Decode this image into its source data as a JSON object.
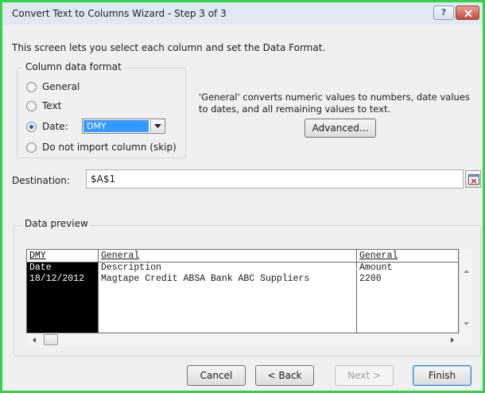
{
  "window": {
    "title": "Convert Text to Columns Wizard - Step 3 of 3",
    "help_glyph": "?"
  },
  "intro_text": "This screen lets you select each column and set the Data Format.",
  "column_format": {
    "legend": "Column data format",
    "options": [
      {
        "label": "General",
        "selected": false
      },
      {
        "label": "Text",
        "selected": false
      },
      {
        "label": "Date:",
        "selected": true
      },
      {
        "label": "Do not import column (skip)",
        "selected": false
      }
    ],
    "date_value": "DMY"
  },
  "general_note": "'General' converts numeric values to numbers, date values to dates, and all remaining values to text.",
  "advanced_label": "Advanced...",
  "destination": {
    "label": "Destination:",
    "value": "$A$1"
  },
  "preview": {
    "legend": "Data preview",
    "headers": [
      "DMY",
      "General",
      "General"
    ],
    "rows": [
      [
        "Date",
        "Description",
        "Amount"
      ],
      [
        "18/12/2012",
        "Magtape Credit ABSA Bank ABC Suppliers",
        "2200"
      ]
    ]
  },
  "buttons": {
    "cancel": "Cancel",
    "back": "< Back",
    "next": "Next >",
    "finish": "Finish"
  },
  "colors": {
    "selection": "#3399ff",
    "frame": "#36d14a"
  }
}
